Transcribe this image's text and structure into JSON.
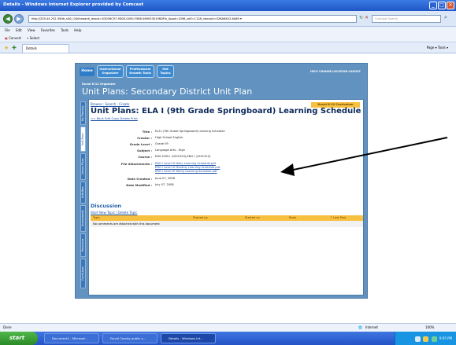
{
  "window": {
    "title": "Details - Windows Internet Explorer provided by Comcast",
    "controls": {
      "minimize": "_",
      "maximize": "□",
      "close": "✕"
    }
  },
  "address_bar": {
    "url": "http://205.44.232.39/tb_s00/_04/forward/_dosdc=03058C97-9D00-0000-F568-0690530198DFfx_Appd=1098_zd0=1128_nexusid=02BA6452-6A69 ▾",
    "search_placeholder": "Comcast Search"
  },
  "menu": [
    "File",
    "Edit",
    "View",
    "Favorites",
    "Tools",
    "Help"
  ],
  "links_bar": {
    "convert": "Convert",
    "select": "Select"
  },
  "tab": {
    "title": "Details"
  },
  "tab_tools": "Page ▾  Tools ▾",
  "app": {
    "home_label": "Home",
    "nav_tabs": [
      {
        "label": "Instructional Organizer"
      },
      {
        "label": "Professional Growth Tools"
      },
      {
        "label": "Hot Topics"
      }
    ],
    "top_links": "HELP   CHANGE LOCATION   LOGOUT",
    "district_label": "Duval K-12 Organizer",
    "header": "Unit Plans: Secondary District Unit Plan",
    "side_tabs": [
      "My Planning",
      "Unit Plans",
      "Lesson Plans",
      "Activities",
      "Assessments",
      "Resources",
      "Curriculum"
    ],
    "active_side_tab": "Unit Plans"
  },
  "content": {
    "breadcrumb": "Browse : Search : Create",
    "badge": "Duval K-12 Curriculum",
    "title": "Unit Plans: ELA I (9th Grade Springboard) Learning Schedule",
    "tools": "<< Back   Edit   Copy   Delete   Print",
    "fields": [
      {
        "label": "Title :",
        "value": "ELA I (9th Grade Springboard) Learning Schedule"
      },
      {
        "label": "Creator :",
        "value": "High School English"
      },
      {
        "label": "Grade Level :",
        "value": "Grade 09"
      },
      {
        "label": "Subject :",
        "value": "Language Arts - High"
      },
      {
        "label": "Course :",
        "value": "ENG HON I (1001320),ENG I (1001310)"
      }
    ],
    "file_attachments_label": "File Attachments :",
    "file_attachments": [
      "ENG I Level IV Daily Learning Schedule.pdf",
      "ENG I Level IV Monthly Learning Schedule.pdf",
      "ENG I Level IV Yearly Learning Schedule.pdf"
    ],
    "dates": [
      {
        "label": "Date Created :",
        "value": "June 07, 2008"
      },
      {
        "label": "Date Modified :",
        "value": "July 07, 2008"
      }
    ],
    "discussion": {
      "heading": "Discussion",
      "links": "Start New Topic  |  Delete Topic",
      "columns": [
        "Topic",
        "Started by",
        "Started on",
        "Posts",
        "↑ Last Post"
      ],
      "empty_message": "No comments are attached with this document"
    }
  },
  "status_bar": {
    "left": "Done",
    "zone": "Internet",
    "zoom": "100%"
  },
  "taskbar": {
    "start": "start",
    "tasks": [
      "Document1 - Microsof...",
      "Duval County public s...",
      "Details - Windows Int..."
    ],
    "clock": "9:05 PM"
  },
  "colors": {
    "accent_blue": "#6192c0",
    "badge_yellow": "#f7c03f",
    "link": "#1b4fa3",
    "arrow": "#000000"
  }
}
